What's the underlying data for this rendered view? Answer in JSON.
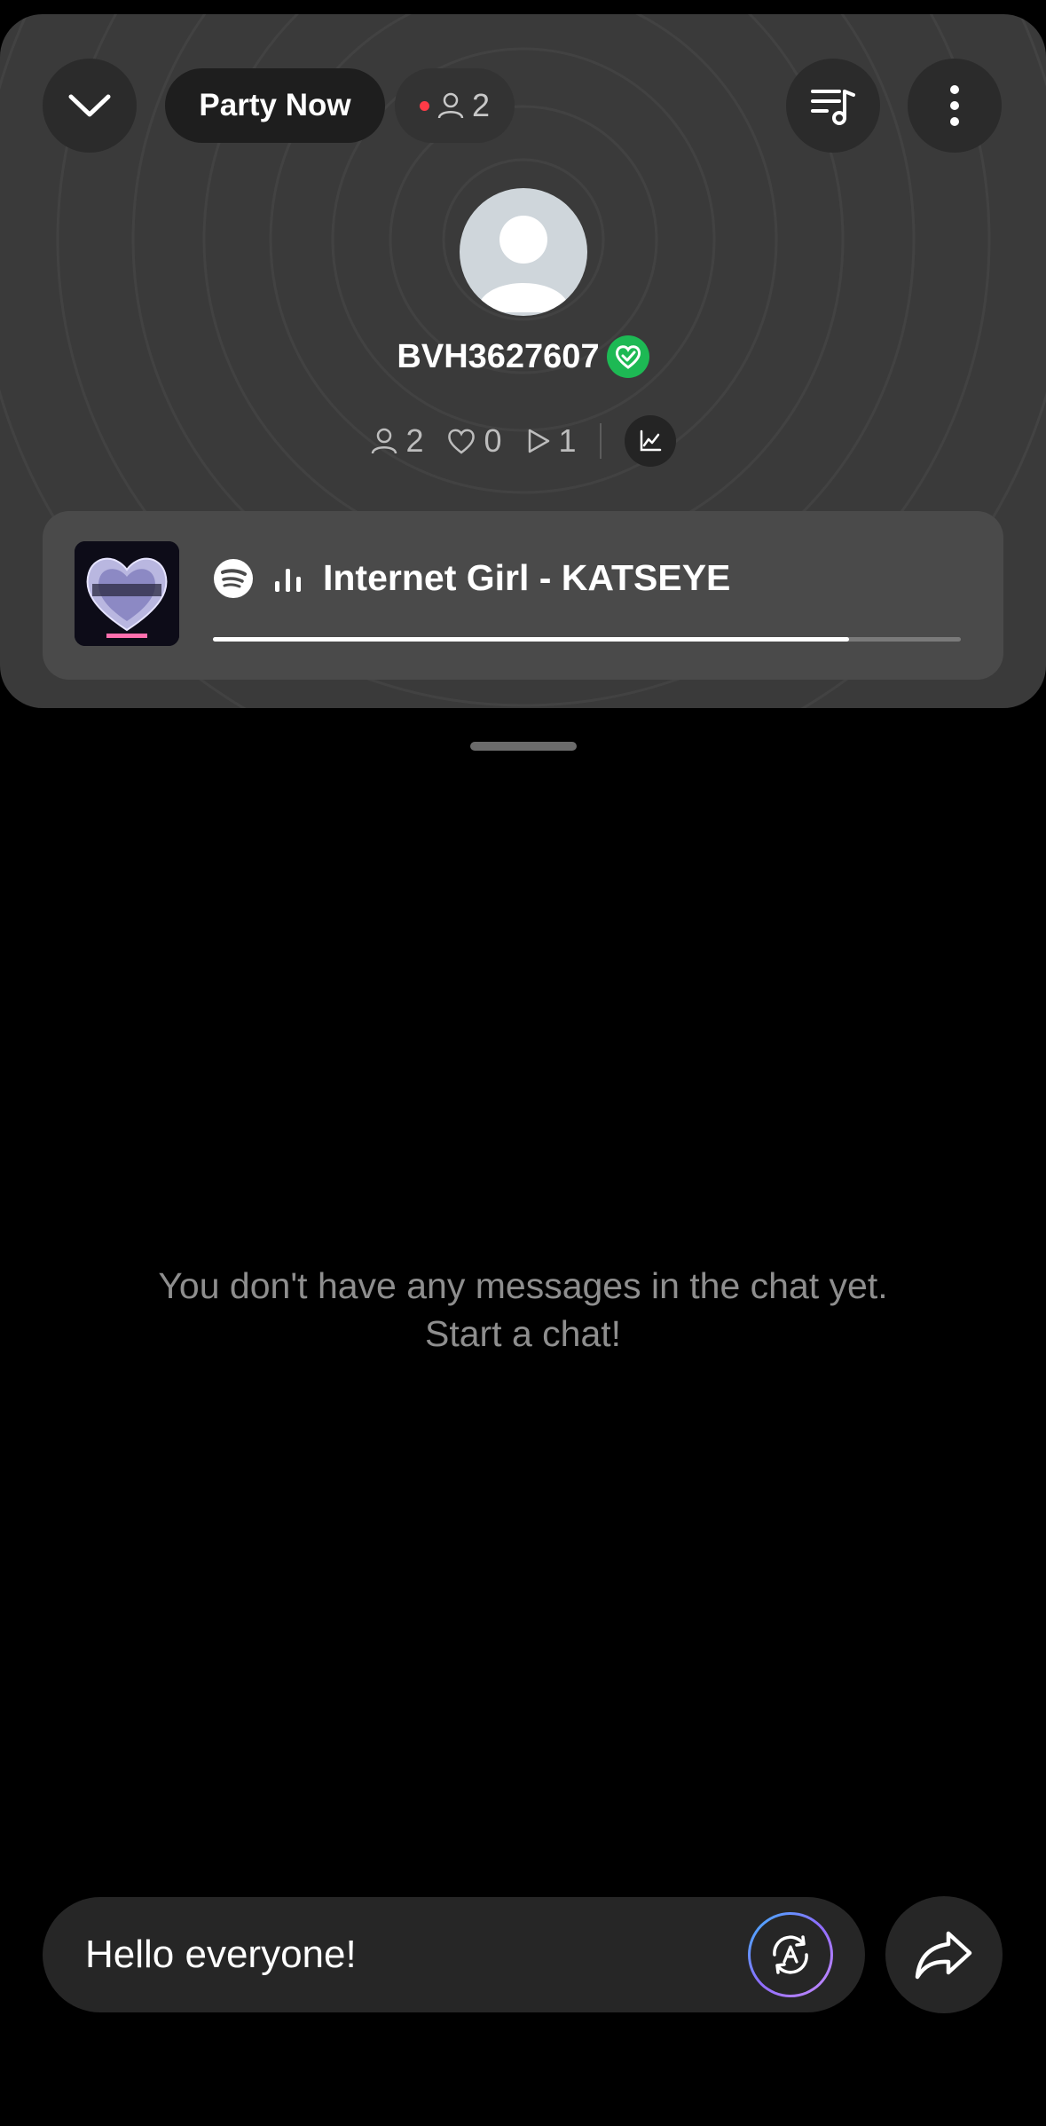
{
  "header": {
    "party_label": "Party Now",
    "viewers_count": "2"
  },
  "host": {
    "username": "BVH3627607"
  },
  "stats": {
    "listeners": "2",
    "likes": "0",
    "plays": "1"
  },
  "now_playing": {
    "track": "Internet Girl - KATSEYE",
    "progress": 0.85
  },
  "chat": {
    "empty_line1": "You don't have any messages in the chat yet.",
    "empty_line2": "Start a chat!"
  },
  "composer": {
    "input_value": "Hello everyone!"
  },
  "colors": {
    "card": "#3a3a3a",
    "spotify_green": "#1db954",
    "live_red": "#ff3b47"
  }
}
